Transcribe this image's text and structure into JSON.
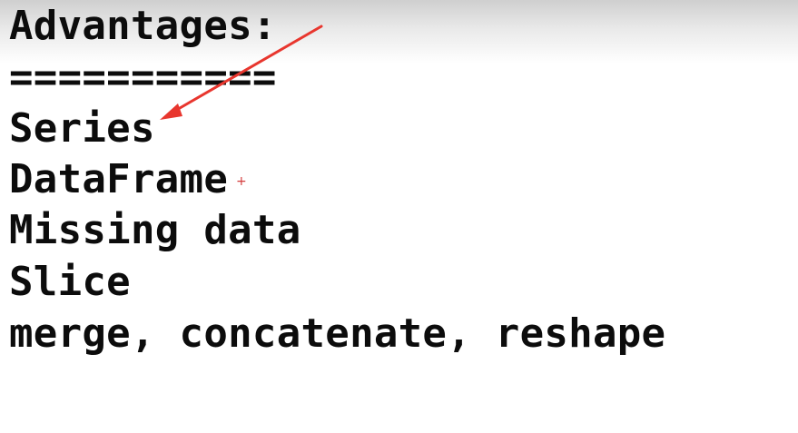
{
  "document": {
    "heading": "Advantages:",
    "underline": "===========",
    "items": [
      "Series",
      "DataFrame",
      "Missing data",
      "Slice",
      "merge, concatenate, reshape"
    ]
  },
  "annotation": {
    "arrow_color": "#e8362e",
    "cursor_icon": "plus-cursor-icon",
    "cursor_glyph": "+",
    "cursor_color": "#d33a3a"
  }
}
